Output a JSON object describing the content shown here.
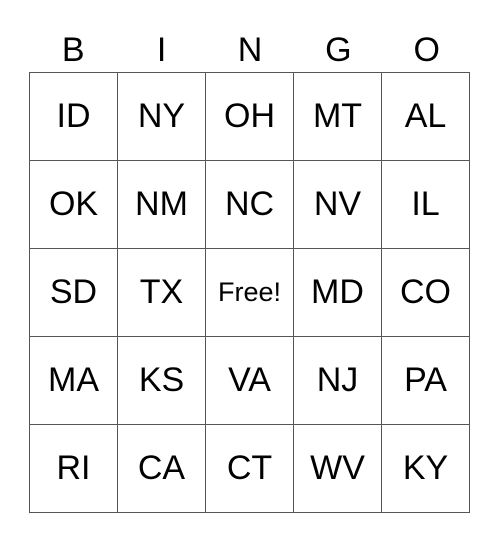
{
  "header": [
    "B",
    "I",
    "N",
    "G",
    "O"
  ],
  "rows": [
    [
      "ID",
      "NY",
      "OH",
      "MT",
      "AL"
    ],
    [
      "OK",
      "NM",
      "NC",
      "NV",
      "IL"
    ],
    [
      "SD",
      "TX",
      "Free!",
      "MD",
      "CO"
    ],
    [
      "MA",
      "KS",
      "VA",
      "NJ",
      "PA"
    ],
    [
      "RI",
      "CA",
      "CT",
      "WV",
      "KY"
    ]
  ]
}
